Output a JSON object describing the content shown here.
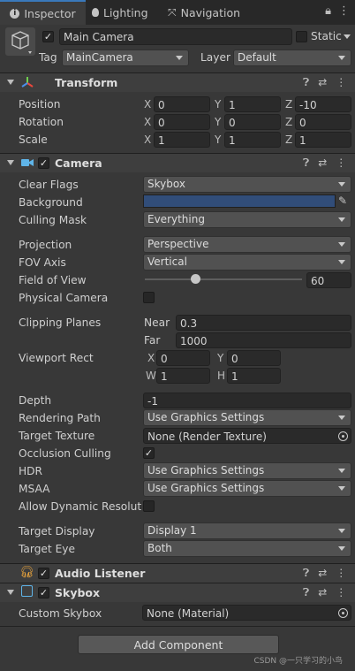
{
  "tabs": [
    {
      "label": "Inspector",
      "icon": "info-icon"
    },
    {
      "label": "Lighting",
      "icon": "bulb-icon"
    },
    {
      "label": "Navigation",
      "icon": "navigation-icon"
    }
  ],
  "object": {
    "name": "Main Camera",
    "static_label": "Static",
    "tag_label": "Tag",
    "tag_value": "MainCamera",
    "layer_label": "Layer",
    "layer_value": "Default"
  },
  "transform": {
    "title": "Transform",
    "rows": [
      {
        "label": "Position",
        "x": "0",
        "y": "1",
        "z": "-10"
      },
      {
        "label": "Rotation",
        "x": "0",
        "y": "0",
        "z": "0"
      },
      {
        "label": "Scale",
        "x": "1",
        "y": "1",
        "z": "1"
      }
    ]
  },
  "axes": {
    "x": "X",
    "y": "Y",
    "z": "Z",
    "w": "W",
    "h": "H"
  },
  "camera": {
    "title": "Camera",
    "clear_flags_label": "Clear Flags",
    "clear_flags": "Skybox",
    "background_label": "Background",
    "background_color": "#314d79",
    "culling_mask_label": "Culling Mask",
    "culling_mask": "Everything",
    "projection_label": "Projection",
    "projection": "Perspective",
    "fov_axis_label": "FOV Axis",
    "fov_axis": "Vertical",
    "fov_label": "Field of View",
    "fov_value": "60",
    "fov_slider_fraction": 0.32,
    "physical_label": "Physical Camera",
    "clipping_label": "Clipping Planes",
    "near_label": "Near",
    "near": "0.3",
    "far_label": "Far",
    "far": "1000",
    "viewport_label": "Viewport Rect",
    "vx": "0",
    "vy": "0",
    "vw": "1",
    "vh": "1",
    "depth_label": "Depth",
    "depth": "-1",
    "rendering_path_label": "Rendering Path",
    "rendering_path": "Use Graphics Settings",
    "target_texture_label": "Target Texture",
    "target_texture": "None (Render Texture)",
    "occlusion_label": "Occlusion Culling",
    "hdr_label": "HDR",
    "hdr": "Use Graphics Settings",
    "msaa_label": "MSAA",
    "msaa": "Use Graphics Settings",
    "dynres_label": "Allow Dynamic Resolutio",
    "target_display_label": "Target Display",
    "target_display": "Display 1",
    "target_eye_label": "Target Eye",
    "target_eye": "Both"
  },
  "audio_listener": {
    "title": "Audio Listener"
  },
  "skybox": {
    "title": "Skybox",
    "custom_label": "Custom Skybox",
    "custom_value": "None (Material)"
  },
  "add_component": "Add Component",
  "watermark": "CSDN @一只学习的小鸟"
}
